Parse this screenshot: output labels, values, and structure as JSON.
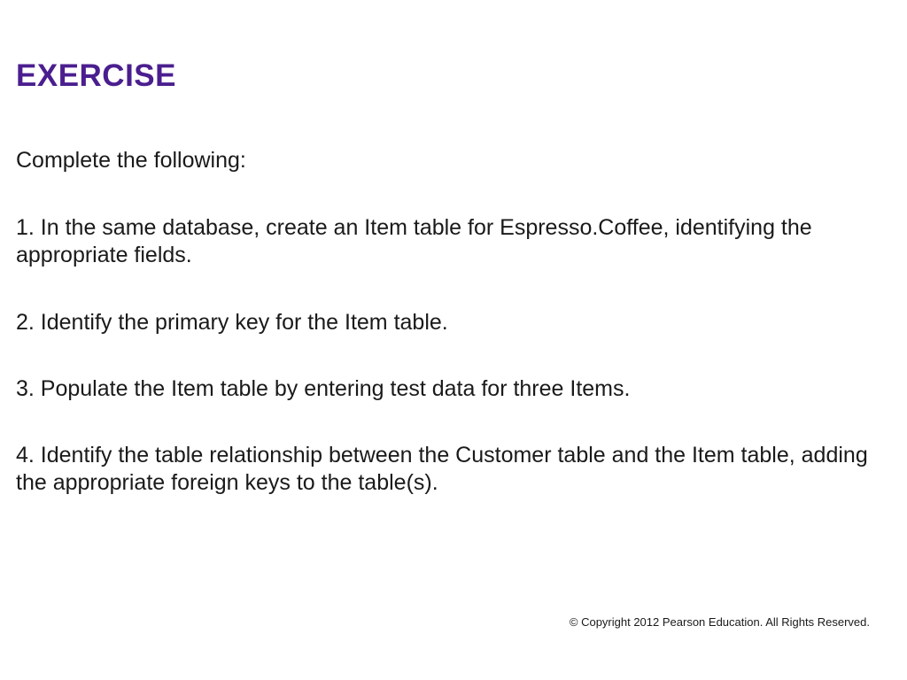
{
  "title": "EXERCISE",
  "intro": "Complete the following:",
  "items": [
    "1. In the same database, create an Item table for Espresso.Coffee, identifying the appropriate fields.",
    "2. Identify the primary key for the Item table.",
    "3. Populate the Item table by entering test data for three Items.",
    "4. Identify the table relationship between the Customer table and the Item table, adding the appropriate foreign keys to the table(s)."
  ],
  "footer": "© Copyright 2012 Pearson Education. All Rights Reserved."
}
